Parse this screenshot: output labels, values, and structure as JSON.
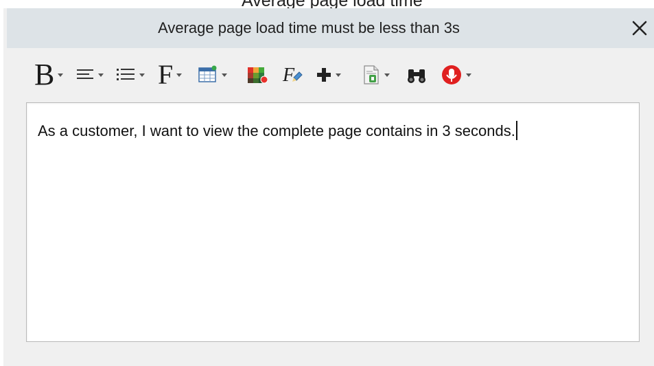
{
  "header_fragment": "Average page load time",
  "dialog": {
    "title": "Average page load time must be less than 3s",
    "close_icon": "close-icon"
  },
  "toolbar": {
    "bold_glyph": "B",
    "font_glyph": "F",
    "items": [
      {
        "icon": "bold-icon",
        "has_dropdown": true
      },
      {
        "icon": "align-left-icon",
        "has_dropdown": true
      },
      {
        "icon": "bulleted-list-icon",
        "has_dropdown": true
      },
      {
        "icon": "font-icon",
        "has_dropdown": true
      },
      {
        "icon": "insert-table-icon",
        "has_dropdown": true
      },
      {
        "icon": "color-picker-icon",
        "has_dropdown": false
      },
      {
        "icon": "formula-icon",
        "has_dropdown": false
      },
      {
        "icon": "plus-icon",
        "has_dropdown": true
      },
      {
        "icon": "document-icon",
        "has_dropdown": true
      },
      {
        "icon": "binoculars-icon",
        "has_dropdown": false
      },
      {
        "icon": "microphone-icon",
        "has_dropdown": true
      }
    ]
  },
  "editor": {
    "text": "As a customer, I want to view the complete page contains in 3 seconds."
  }
}
